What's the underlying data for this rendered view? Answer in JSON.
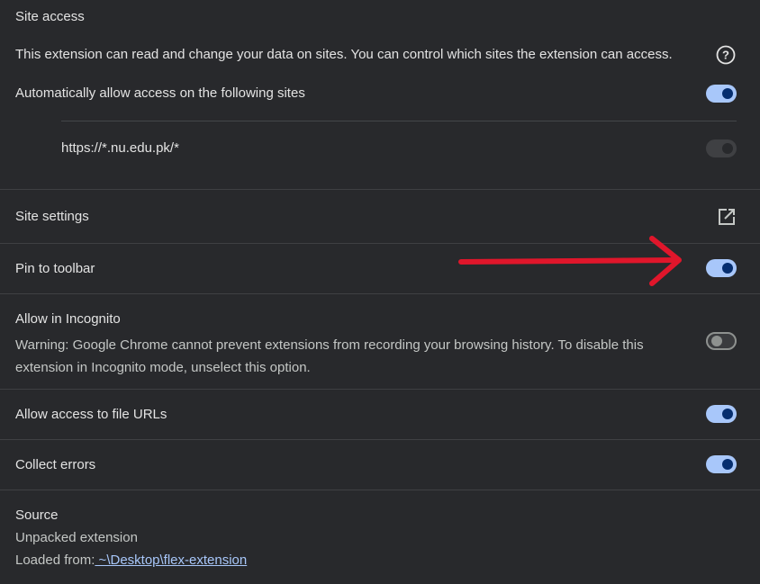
{
  "site_access": {
    "title": "Site access",
    "description": "This extension can read and change your data on sites. You can control which sites the extension can access.",
    "auto_allow_label": "Automatically allow access on the following sites",
    "auto_allow_enabled": true,
    "sites": [
      {
        "url": "https://*.nu.edu.pk/*",
        "enabled": true
      }
    ]
  },
  "site_settings": {
    "label": "Site settings",
    "icon": "open-in-new-icon"
  },
  "pin_to_toolbar": {
    "label": "Pin to toolbar",
    "enabled": true
  },
  "incognito": {
    "label": "Allow in Incognito",
    "warning": "Warning: Google Chrome cannot prevent extensions from recording your browsing history. To disable this extension in Incognito mode, unselect this option.",
    "enabled": false
  },
  "file_urls": {
    "label": "Allow access to file URLs",
    "enabled": true
  },
  "collect_errors": {
    "label": "Collect errors",
    "enabled": true
  },
  "source": {
    "title": "Source",
    "type": "Unpacked extension",
    "loaded_from_label": "Loaded from:",
    "loaded_from_path": " ~\\Desktop\\flex-extension"
  },
  "colors": {
    "background": "#28292c",
    "toggle_on": "#a8c7fa",
    "knob_on": "#062e6f",
    "arrow": "#e0162b",
    "link": "#a8c7fa"
  }
}
